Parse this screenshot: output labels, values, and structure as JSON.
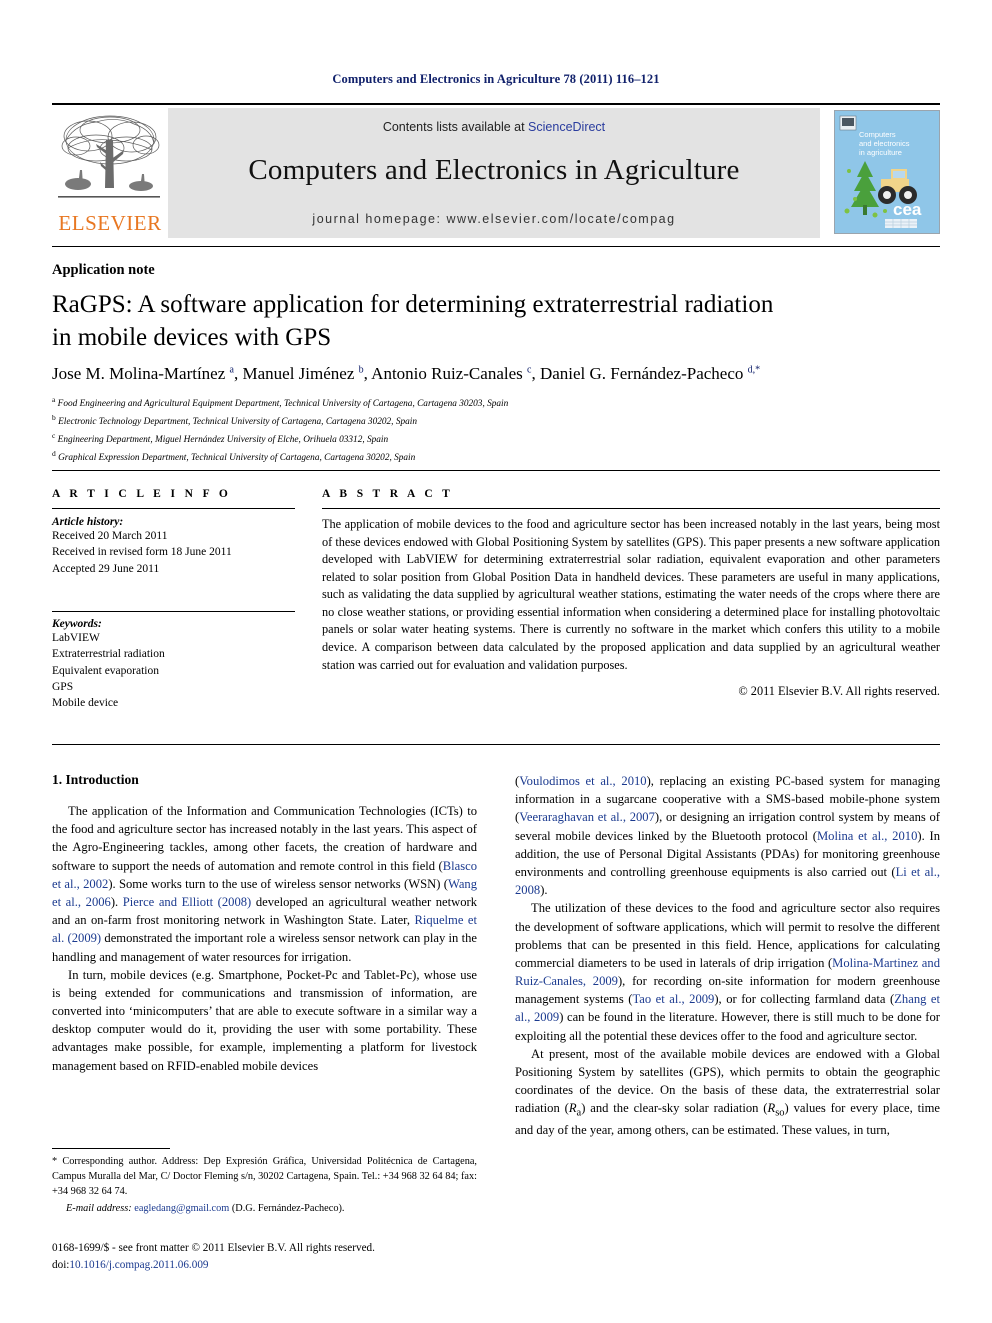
{
  "running_head": "Computers and Electronics in Agriculture 78 (2011) 116–121",
  "masthead": {
    "contents_prefix": "Contents lists available at ",
    "sciencedirect": "ScienceDirect",
    "journal_title": "Computers and Electronics in Agriculture",
    "homepage": "journal homepage: www.elsevier.com/locate/compag",
    "publisher_name": "ELSEVIER",
    "cover_title_line1": "Computers",
    "cover_title_line2": "and electronics",
    "cover_title_line3": "in agriculture",
    "cover_logo_text": "cea",
    "accent_orange": "#e87722",
    "link_blue": "#2a3c9e",
    "cover_blue": "#8fc6e8"
  },
  "article": {
    "type": "Application note",
    "title_line1": "RaGPS: A software application for determining extraterrestrial radiation",
    "title_line2": "in mobile devices with GPS",
    "authors": "Jose M. Molina-Martínez a, Manuel Jiménez b, Antonio Ruiz-Canales c, Daniel G. Fernández-Pacheco d,*",
    "affiliations": [
      "a Food Engineering and Agricultural Equipment Department, Technical University of Cartagena, Cartagena 30203, Spain",
      "b Electronic Technology Department, Technical University of Cartagena, Cartagena 30202, Spain",
      "c Engineering Department, Miguel Hernández University of Elche, Orihuela 03312, Spain",
      "d Graphical Expression Department, Technical University of Cartagena, Cartagena 30202, Spain"
    ]
  },
  "article_info": {
    "heading": "A R T I C L E    I N F O",
    "history_label": "Article history:",
    "history": [
      "Received 20 March 2011",
      "Received in revised form 18 June 2011",
      "Accepted 29 June 2011"
    ],
    "keywords_label": "Keywords:",
    "keywords": [
      "LabVIEW",
      "Extraterrestrial radiation",
      "Equivalent evaporation",
      "GPS",
      "Mobile device"
    ]
  },
  "abstract": {
    "heading": "A B S T R A C T",
    "body": "The application of mobile devices to the food and agriculture sector has been increased notably in the last years, being most of these devices endowed with Global Positioning System by satellites (GPS). This paper presents a new software application developed with LabVIEW for determining extraterrestrial solar radiation, equivalent evaporation and other parameters related to solar position from Global Position Data in handheld devices. These parameters are useful in many applications, such as validating the data supplied by agricultural weather stations, estimating the water needs of the crops where there are no close weather stations, or providing essential information when considering a determined place for installing photovoltaic panels or solar water heating systems. There is currently no software in the market which confers this utility to a mobile device. A comparison between data calculated by the proposed application and data supplied by an agricultural weather station was carried out for evaluation and validation purposes.",
    "copyright": "© 2011 Elsevier B.V. All rights reserved."
  },
  "body": {
    "section_heading": "1. Introduction",
    "left_paragraphs": [
      "The application of the Information and Communication Technologies (ICTs) to the food and agriculture sector has increased notably in the last years. This aspect of the Agro-Engineering tackles, among other facets, the creation of hardware and software to support the needs of automation and remote control in this field (Blasco et al., 2002). Some works turn to the use of wireless sensor networks (WSN) (Wang et al., 2006). Pierce and Elliott (2008) developed an agricultural weather network and an on-farm frost monitoring network in Washington State. Later, Riquelme et al. (2009) demonstrated the important role a wireless sensor network can play in the handling and management of water resources for irrigation.",
      "In turn, mobile devices (e.g. Smartphone, Pocket-Pc and Tablet-Pc), whose use is being extended for communications and transmission of information, are converted into 'minicomputers' that are able to execute software in a similar way a desktop computer would do it, providing the user with some portability. These advantages make possible, for example, implementing a platform for livestock management based on RFID-enabled mobile devices"
    ],
    "right_paragraphs": [
      "(Voulodimos et al., 2010), replacing an existing PC-based system for managing information in a sugarcane cooperative with a SMS-based mobile-phone system (Veeraraghavan et al., 2007), or designing an irrigation control system by means of several mobile devices linked by the Bluetooth protocol (Molina et al., 2010). In addition, the use of Personal Digital Assistants (PDAs) for monitoring greenhouse environments and controlling greenhouse equipments is also carried out (Li et al., 2008).",
      "The utilization of these devices to the food and agriculture sector also requires the development of software applications, which will permit to resolve the different problems that can be presented in this field. Hence, applications for calculating commercial diameters to be used in laterals of drip irrigation (Molina-Martinez and Ruiz-Canales, 2009), for recording on-site information for modern greenhouse management systems (Tao et al., 2009), or for collecting farmland data (Zhang et al., 2009) can be found in the literature. However, there is still much to be done for exploiting all the potential these devices offer to the food and agriculture sector.",
      "At present, most of the available mobile devices are endowed with a Global Positioning System by satellites (GPS), which permits to obtain the geographic coordinates of the device. On the basis of these data, the extraterrestrial solar radiation (Ra) and the clear-sky solar radiation (Rso) values for every place, time and day of the year, among others, can be estimated. These values, in turn,"
    ]
  },
  "footnotes": {
    "corresponding": "* Corresponding author. Address: Dep Expresión Gráfica, Universidad Politécnica de Cartagena, Campus Muralla del Mar, C/ Doctor Fleming s/n, 30202 Cartagena, Spain. Tel.: +34 968 32 64 84; fax: +34 968 32 64 74.",
    "email_label": "E-mail address:",
    "email": "eagledang@gmail.com",
    "email_suffix": "(D.G. Fernández-Pacheco)."
  },
  "imprint": {
    "line1": "0168-1699/$ - see front matter © 2011 Elsevier B.V. All rights reserved.",
    "doi_prefix": "doi:",
    "doi": "10.1016/j.compag.2011.06.009"
  }
}
